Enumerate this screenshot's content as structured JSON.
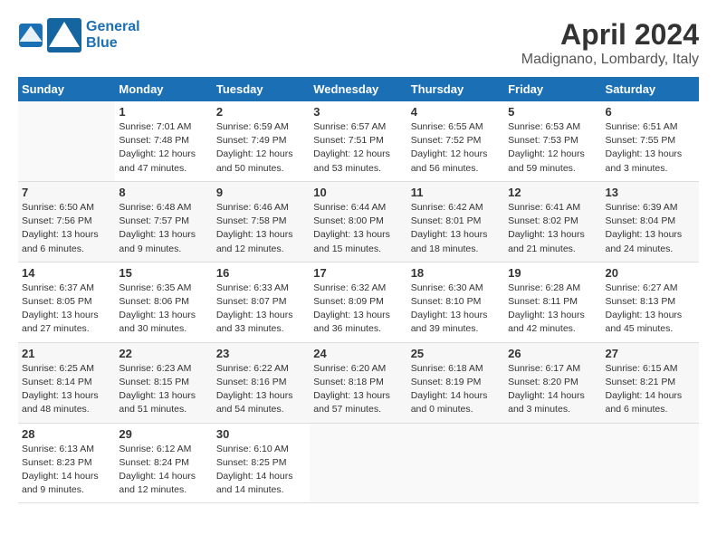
{
  "header": {
    "logo_line1": "General",
    "logo_line2": "Blue",
    "month": "April 2024",
    "location": "Madignano, Lombardy, Italy"
  },
  "weekdays": [
    "Sunday",
    "Monday",
    "Tuesday",
    "Wednesday",
    "Thursday",
    "Friday",
    "Saturday"
  ],
  "weeks": [
    [
      {
        "day": "",
        "info": ""
      },
      {
        "day": "1",
        "info": "Sunrise: 7:01 AM\nSunset: 7:48 PM\nDaylight: 12 hours\nand 47 minutes."
      },
      {
        "day": "2",
        "info": "Sunrise: 6:59 AM\nSunset: 7:49 PM\nDaylight: 12 hours\nand 50 minutes."
      },
      {
        "day": "3",
        "info": "Sunrise: 6:57 AM\nSunset: 7:51 PM\nDaylight: 12 hours\nand 53 minutes."
      },
      {
        "day": "4",
        "info": "Sunrise: 6:55 AM\nSunset: 7:52 PM\nDaylight: 12 hours\nand 56 minutes."
      },
      {
        "day": "5",
        "info": "Sunrise: 6:53 AM\nSunset: 7:53 PM\nDaylight: 12 hours\nand 59 minutes."
      },
      {
        "day": "6",
        "info": "Sunrise: 6:51 AM\nSunset: 7:55 PM\nDaylight: 13 hours\nand 3 minutes."
      }
    ],
    [
      {
        "day": "7",
        "info": "Sunrise: 6:50 AM\nSunset: 7:56 PM\nDaylight: 13 hours\nand 6 minutes."
      },
      {
        "day": "8",
        "info": "Sunrise: 6:48 AM\nSunset: 7:57 PM\nDaylight: 13 hours\nand 9 minutes."
      },
      {
        "day": "9",
        "info": "Sunrise: 6:46 AM\nSunset: 7:58 PM\nDaylight: 13 hours\nand 12 minutes."
      },
      {
        "day": "10",
        "info": "Sunrise: 6:44 AM\nSunset: 8:00 PM\nDaylight: 13 hours\nand 15 minutes."
      },
      {
        "day": "11",
        "info": "Sunrise: 6:42 AM\nSunset: 8:01 PM\nDaylight: 13 hours\nand 18 minutes."
      },
      {
        "day": "12",
        "info": "Sunrise: 6:41 AM\nSunset: 8:02 PM\nDaylight: 13 hours\nand 21 minutes."
      },
      {
        "day": "13",
        "info": "Sunrise: 6:39 AM\nSunset: 8:04 PM\nDaylight: 13 hours\nand 24 minutes."
      }
    ],
    [
      {
        "day": "14",
        "info": "Sunrise: 6:37 AM\nSunset: 8:05 PM\nDaylight: 13 hours\nand 27 minutes."
      },
      {
        "day": "15",
        "info": "Sunrise: 6:35 AM\nSunset: 8:06 PM\nDaylight: 13 hours\nand 30 minutes."
      },
      {
        "day": "16",
        "info": "Sunrise: 6:33 AM\nSunset: 8:07 PM\nDaylight: 13 hours\nand 33 minutes."
      },
      {
        "day": "17",
        "info": "Sunrise: 6:32 AM\nSunset: 8:09 PM\nDaylight: 13 hours\nand 36 minutes."
      },
      {
        "day": "18",
        "info": "Sunrise: 6:30 AM\nSunset: 8:10 PM\nDaylight: 13 hours\nand 39 minutes."
      },
      {
        "day": "19",
        "info": "Sunrise: 6:28 AM\nSunset: 8:11 PM\nDaylight: 13 hours\nand 42 minutes."
      },
      {
        "day": "20",
        "info": "Sunrise: 6:27 AM\nSunset: 8:13 PM\nDaylight: 13 hours\nand 45 minutes."
      }
    ],
    [
      {
        "day": "21",
        "info": "Sunrise: 6:25 AM\nSunset: 8:14 PM\nDaylight: 13 hours\nand 48 minutes."
      },
      {
        "day": "22",
        "info": "Sunrise: 6:23 AM\nSunset: 8:15 PM\nDaylight: 13 hours\nand 51 minutes."
      },
      {
        "day": "23",
        "info": "Sunrise: 6:22 AM\nSunset: 8:16 PM\nDaylight: 13 hours\nand 54 minutes."
      },
      {
        "day": "24",
        "info": "Sunrise: 6:20 AM\nSunset: 8:18 PM\nDaylight: 13 hours\nand 57 minutes."
      },
      {
        "day": "25",
        "info": "Sunrise: 6:18 AM\nSunset: 8:19 PM\nDaylight: 14 hours\nand 0 minutes."
      },
      {
        "day": "26",
        "info": "Sunrise: 6:17 AM\nSunset: 8:20 PM\nDaylight: 14 hours\nand 3 minutes."
      },
      {
        "day": "27",
        "info": "Sunrise: 6:15 AM\nSunset: 8:21 PM\nDaylight: 14 hours\nand 6 minutes."
      }
    ],
    [
      {
        "day": "28",
        "info": "Sunrise: 6:13 AM\nSunset: 8:23 PM\nDaylight: 14 hours\nand 9 minutes."
      },
      {
        "day": "29",
        "info": "Sunrise: 6:12 AM\nSunset: 8:24 PM\nDaylight: 14 hours\nand 12 minutes."
      },
      {
        "day": "30",
        "info": "Sunrise: 6:10 AM\nSunset: 8:25 PM\nDaylight: 14 hours\nand 14 minutes."
      },
      {
        "day": "",
        "info": ""
      },
      {
        "day": "",
        "info": ""
      },
      {
        "day": "",
        "info": ""
      },
      {
        "day": "",
        "info": ""
      }
    ]
  ]
}
